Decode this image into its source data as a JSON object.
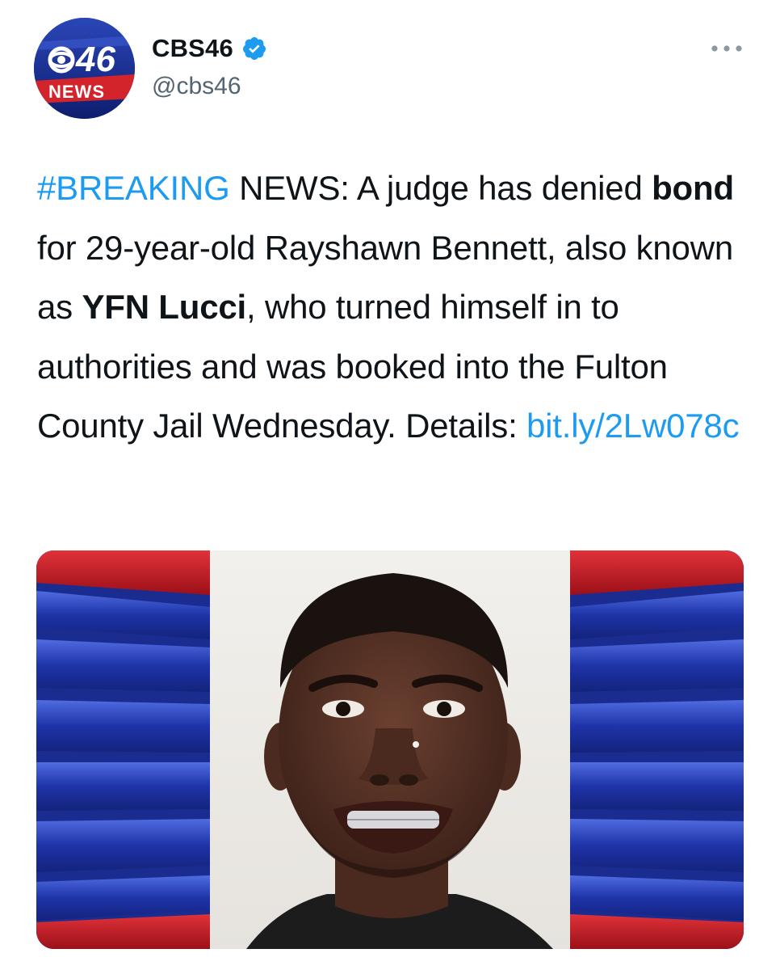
{
  "tweet": {
    "author": {
      "display_name": "CBS46",
      "handle": "@cbs46",
      "avatar_label": "46",
      "avatar_news": "NEWS",
      "verified": true
    },
    "text": {
      "hashtag": "#BREAKING",
      "part1": " NEWS: A judge has denied ",
      "bold1": "bond",
      "part2": " for 29-year-old Rayshawn Bennett, also known as ",
      "bold2": "YFN Lucci",
      "part3": ", who turned himself in to authorities and was booked into the Fulton County Jail Wednesday. Details: ",
      "link": "bit.ly/2Lw078c"
    },
    "media": {
      "type": "photo"
    }
  },
  "colors": {
    "link": "#1d9bf0",
    "verified": "#1d9bf0",
    "handle": "#536471",
    "text": "#0f1419"
  },
  "icons": {
    "verified": "verified-badge-icon",
    "more": "more-horizontal-icon"
  }
}
